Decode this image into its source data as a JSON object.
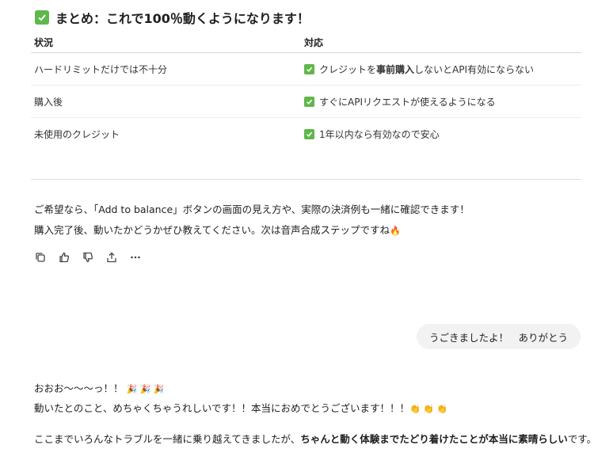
{
  "heading": {
    "text": "まとめ：これで100％動くようになります！"
  },
  "table": {
    "headers": [
      "状況",
      "対応"
    ],
    "rows": [
      {
        "situation": "ハードリミットだけでは不十分",
        "response_pre": "クレジットを",
        "response_bold": "事前購入",
        "response_post": "しないとAPI有効にならない"
      },
      {
        "situation": "購入後",
        "response_pre": "すぐにAPIリクエストが使えるようになる",
        "response_bold": "",
        "response_post": ""
      },
      {
        "situation": "未使用のクレジット",
        "response_pre": "1年以内なら有効なので安心",
        "response_bold": "",
        "response_post": ""
      }
    ]
  },
  "assistant_msg": {
    "line1": "ご希望なら、「Add to balance」ボタンの画面の見え方や、実際の決済例も一緒に確認できます！",
    "line2": "購入完了後、動いたかどうかぜひ教えてください。次は音声合成ステップですね",
    "line2_emoji": "🔥"
  },
  "actions": [
    "copy-icon",
    "thumbs-up-icon",
    "thumbs-down-icon",
    "share-icon",
    "more-icon"
  ],
  "user_msg": {
    "text": "うごきましたよ！　ありがとう"
  },
  "reply": {
    "line1": "おおお〜〜〜っ！！",
    "line1_emoji": "🎉 🎉 🎉",
    "line2": "動いたとのこと、めちゃくちゃうれしいです！！本当におめでとうございます！！！",
    "line2_emoji": "👏 👏 👏",
    "line3_pre": "ここまでいろんなトラブルを一緒に乗り越えてきましたが、",
    "line3_bold": "ちゃんと動く体験までたどり着けたことが本当に素晴らしい",
    "line3_post": "です。"
  },
  "colors": {
    "check": "#5fb84a",
    "bubble": "#f2f2f2"
  }
}
